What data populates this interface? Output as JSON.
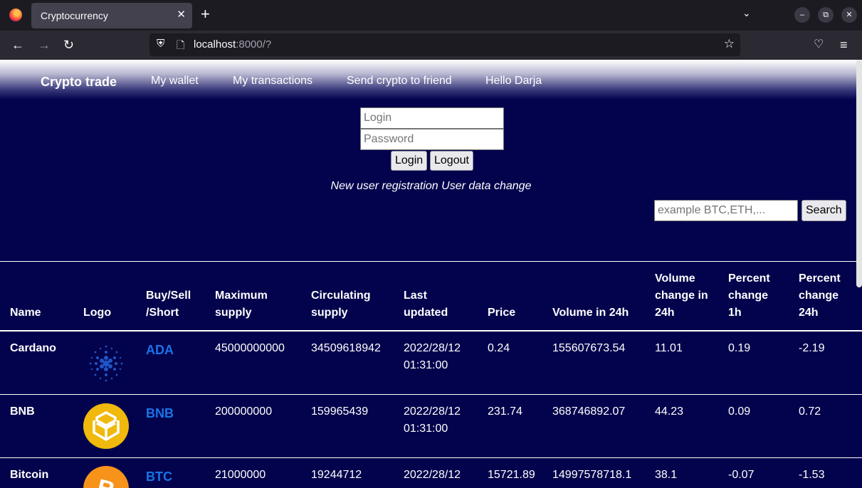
{
  "browser": {
    "tab_title": "Cryptocurrency",
    "url_host": "localhost",
    "url_rest": ":8000/?"
  },
  "nav": {
    "brand": "Crypto trade",
    "links": [
      "My wallet",
      "My transactions",
      "Send crypto to friend",
      "Hello Darja"
    ]
  },
  "login": {
    "login_placeholder": "Login",
    "password_placeholder": "Password",
    "login_button": "Login",
    "logout_button": "Logout",
    "register_link": "New user registration",
    "change_link": "User data change"
  },
  "search": {
    "placeholder": "example BTC,ETH,...",
    "button": "Search"
  },
  "table": {
    "headers": {
      "name": "Name",
      "logo": "Logo",
      "buy": [
        "Buy/Sell",
        "/Short"
      ],
      "max": [
        "Maximum",
        "supply"
      ],
      "circ": [
        "Circulating",
        "supply"
      ],
      "updated": [
        "Last",
        "updated"
      ],
      "price": "Price",
      "volume": "Volume in 24h",
      "volchange": [
        "Volume",
        "change in",
        "24h"
      ],
      "pct1h": [
        "Percent",
        "change",
        "1h"
      ],
      "pct24h": [
        "Percent",
        "change",
        "24h"
      ]
    },
    "rows": [
      {
        "name": "Cardano",
        "logo": "cardano-logo",
        "symbol": "ADA",
        "max_supply": "45000000000",
        "circulating": "34509618942",
        "updated_date": "2022/28/12",
        "updated_time": "01:31:00",
        "price": "0.24",
        "volume": "155607673.54",
        "vol_change": "11.01",
        "pct_1h": "0.19",
        "pct_24h": "-2.19"
      },
      {
        "name": "BNB",
        "logo": "bnb-logo",
        "symbol": "BNB",
        "max_supply": "200000000",
        "circulating": "159965439",
        "updated_date": "2022/28/12",
        "updated_time": "01:31:00",
        "price": "231.74",
        "volume": "368746892.07",
        "vol_change": "44.23",
        "pct_1h": "0.09",
        "pct_24h": "0.72"
      },
      {
        "name": "Bitcoin",
        "logo": "bitcoin-logo",
        "symbol": "BTC",
        "max_supply": "21000000",
        "circulating": "19244712",
        "updated_date": "2022/28/12",
        "updated_time": "",
        "price": "15721.89",
        "volume": "14997578718.1",
        "vol_change": "38.1",
        "pct_1h": "-0.07",
        "pct_24h": "-1.53"
      }
    ]
  }
}
